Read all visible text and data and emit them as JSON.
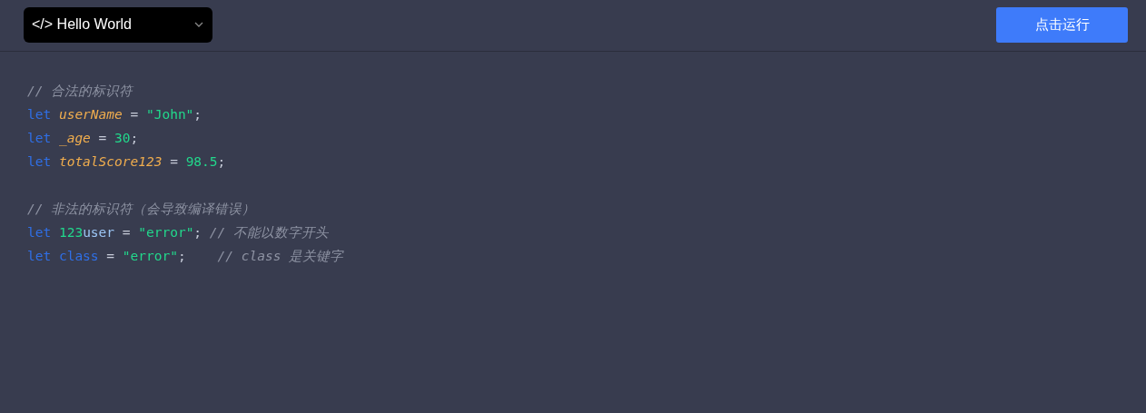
{
  "toolbar": {
    "example_select": {
      "value": "</> Hello World"
    },
    "run_button": {
      "label": "点击运行"
    }
  },
  "code_lines": [
    {
      "kind": "code",
      "tokens": [
        {
          "kind": "comment",
          "text": "// 合法的标识符"
        }
      ]
    },
    {
      "kind": "code",
      "tokens": [
        {
          "kind": "keyword",
          "text": "let"
        },
        {
          "kind": "variable",
          "text": "userName"
        },
        {
          "kind": "punct",
          "text": " = "
        },
        {
          "kind": "string",
          "text": "\"John\""
        },
        {
          "kind": "punct",
          "text": ";"
        }
      ]
    },
    {
      "kind": "code",
      "tokens": [
        {
          "kind": "keyword",
          "text": "let"
        },
        {
          "kind": "variable",
          "text": "_age"
        },
        {
          "kind": "punct",
          "text": " = "
        },
        {
          "kind": "number",
          "text": "30"
        },
        {
          "kind": "punct",
          "text": ";"
        }
      ]
    },
    {
      "kind": "code",
      "tokens": [
        {
          "kind": "keyword",
          "text": "let"
        },
        {
          "kind": "variable",
          "text": "totalScore123"
        },
        {
          "kind": "punct",
          "text": " = "
        },
        {
          "kind": "number",
          "text": "98.5"
        },
        {
          "kind": "punct",
          "text": ";"
        }
      ]
    },
    {
      "kind": "blank"
    },
    {
      "kind": "code",
      "tokens": [
        {
          "kind": "comment",
          "text": "// 非法的标识符（会导致编译错误）"
        }
      ]
    },
    {
      "kind": "code",
      "tokens": [
        {
          "kind": "keyword",
          "text": "let"
        },
        {
          "kind": "number",
          "text": "123"
        },
        {
          "kind": "identifier",
          "text": "user"
        },
        {
          "kind": "punct",
          "text": " = "
        },
        {
          "kind": "string",
          "text": "\"error\""
        },
        {
          "kind": "punct",
          "text": "; "
        },
        {
          "kind": "comment",
          "text": "// 不能以数字开头"
        }
      ]
    },
    {
      "kind": "code",
      "tokens": [
        {
          "kind": "keyword",
          "text": "let"
        },
        {
          "kind": "keyword",
          "text": "class"
        },
        {
          "kind": "punct",
          "text": " = "
        },
        {
          "kind": "string",
          "text": "\"error\""
        },
        {
          "kind": "punct",
          "text": ";    "
        },
        {
          "kind": "comment",
          "text": "// class 是关键字"
        }
      ]
    }
  ]
}
